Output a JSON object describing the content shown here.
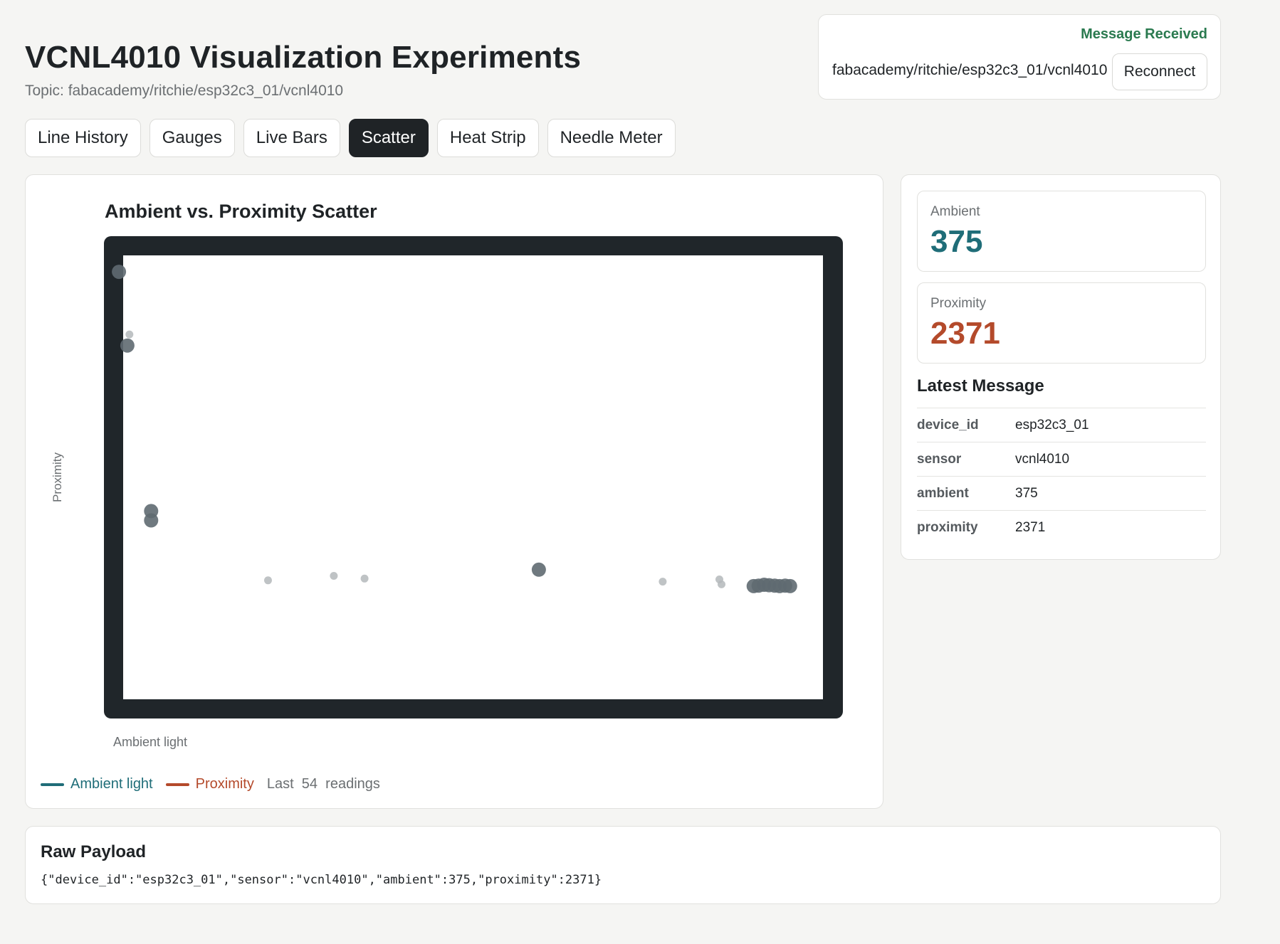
{
  "page": {
    "title": "VCNL4010 Visualization Experiments",
    "topic_line": "Topic: fabacademy/ritchie/esp32c3_01/vcnl4010"
  },
  "connection": {
    "status": "Message Received",
    "topic": "fabacademy/ritchie/esp32c3_01/vcnl4010",
    "reconnect_label": "Reconnect",
    "status_color": "#2a7a4f"
  },
  "tabs": [
    {
      "label": "Line History",
      "active": false
    },
    {
      "label": "Gauges",
      "active": false
    },
    {
      "label": "Live Bars",
      "active": false
    },
    {
      "label": "Scatter",
      "active": true
    },
    {
      "label": "Heat Strip",
      "active": false
    },
    {
      "label": "Needle Meter",
      "active": false
    }
  ],
  "chart": {
    "title": "Ambient vs. Proximity Scatter",
    "xlabel": "Ambient light",
    "ylabel": "Proximity",
    "legend": {
      "ambient_label": "Ambient light",
      "proximity_label": "Proximity",
      "readings_prefix": "Last",
      "readings_count": "54",
      "readings_suffix": "readings"
    }
  },
  "chart_data": {
    "type": "scatter",
    "title": "Ambient vs. Proximity Scatter",
    "xlabel": "Ambient light",
    "ylabel": "Proximity",
    "legend": "bottom-left",
    "grid": false,
    "xlim": [
      0,
      1
    ],
    "ylim": [
      0,
      1
    ],
    "series": [
      {
        "name": "Ambient light",
        "color": "#1f6d78"
      },
      {
        "name": "Proximity",
        "color": "#b44a2b"
      }
    ],
    "points": [
      {
        "x": -0.006,
        "y": 0.963,
        "emphasis": "strong"
      },
      {
        "x": 0.009,
        "y": 0.822,
        "emphasis": "faint"
      },
      {
        "x": 0.006,
        "y": 0.797,
        "emphasis": "strong"
      },
      {
        "x": 0.04,
        "y": 0.424,
        "emphasis": "strong"
      },
      {
        "x": 0.04,
        "y": 0.403,
        "emphasis": "strong"
      },
      {
        "x": 0.207,
        "y": 0.268,
        "emphasis": "faint"
      },
      {
        "x": 0.301,
        "y": 0.278,
        "emphasis": "faint"
      },
      {
        "x": 0.345,
        "y": 0.272,
        "emphasis": "faint"
      },
      {
        "x": 0.594,
        "y": 0.292,
        "emphasis": "strong"
      },
      {
        "x": 0.771,
        "y": 0.265,
        "emphasis": "faint"
      },
      {
        "x": 0.852,
        "y": 0.27,
        "emphasis": "faint"
      },
      {
        "x": 0.855,
        "y": 0.259,
        "emphasis": "faint"
      },
      {
        "x": 0.901,
        "y": 0.255,
        "emphasis": "strong"
      },
      {
        "x": 0.908,
        "y": 0.256,
        "emphasis": "strong"
      },
      {
        "x": 0.916,
        "y": 0.258,
        "emphasis": "strong"
      },
      {
        "x": 0.923,
        "y": 0.257,
        "emphasis": "strong"
      },
      {
        "x": 0.931,
        "y": 0.256,
        "emphasis": "strong"
      },
      {
        "x": 0.938,
        "y": 0.255,
        "emphasis": "strong"
      },
      {
        "x": 0.946,
        "y": 0.256,
        "emphasis": "strong"
      },
      {
        "x": 0.953,
        "y": 0.255,
        "emphasis": "strong"
      }
    ]
  },
  "metrics": {
    "ambient": {
      "label": "Ambient",
      "value": "375",
      "color": "#1f6d78"
    },
    "proximity": {
      "label": "Proximity",
      "value": "2371",
      "color": "#b44a2b"
    }
  },
  "latest": {
    "title": "Latest Message",
    "rows": [
      {
        "key": "device_id",
        "value": "esp32c3_01"
      },
      {
        "key": "sensor",
        "value": "vcnl4010"
      },
      {
        "key": "ambient",
        "value": "375"
      },
      {
        "key": "proximity",
        "value": "2371"
      }
    ]
  },
  "raw": {
    "title": "Raw Payload",
    "json": "{\"device_id\":\"esp32c3_01\",\"sensor\":\"vcnl4010\",\"ambient\":375,\"proximity\":2371}"
  }
}
